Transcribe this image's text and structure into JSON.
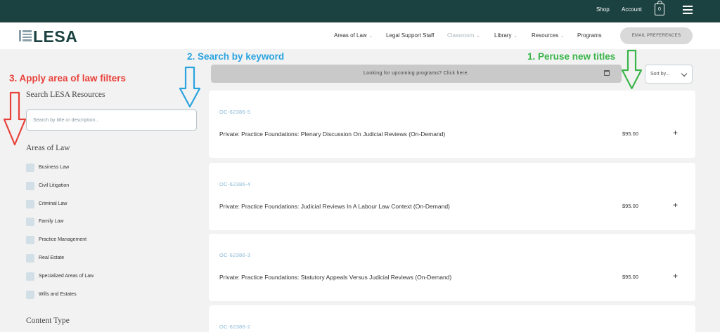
{
  "top_bar": {
    "shop": "Shop",
    "account": "Account",
    "cart_count": "0"
  },
  "brand": {
    "logo_text": "LESA"
  },
  "nav": {
    "items": [
      {
        "label": "Areas of Law",
        "dropdown": true
      },
      {
        "label": "Legal Support Staff",
        "dropdown": false
      },
      {
        "label": "Classroom",
        "dropdown": true
      },
      {
        "label": "Library",
        "dropdown": true
      },
      {
        "label": "Resources",
        "dropdown": true
      },
      {
        "label": "Programs",
        "dropdown": false
      }
    ],
    "email_button": "EMAIL PREFERENCES"
  },
  "annotations": {
    "step1": "1. Peruse new titles",
    "step2": "2. Search by keyword",
    "step3": "3. Apply area of law filters"
  },
  "sidebar": {
    "search_title": "Search LESA Resources",
    "search_placeholder": "Search by title or description...",
    "areas_title": "Areas of Law",
    "areas": [
      "Business Law",
      "Civil Litigation",
      "Criminal Law",
      "Family Law",
      "Practice Management",
      "Real Estate",
      "Specialized Areas of Law",
      "Wills and Estates"
    ],
    "content_type_title": "Content Type"
  },
  "main": {
    "banner": "Looking for upcoming programs? Click here.",
    "sort_label": "Sort by...",
    "cards": [
      {
        "code": "OC-62386-5",
        "title": "Private: Practice Foundations: Plenary Discussion On Judicial Reviews (On-Demand)",
        "price": "$95.00"
      },
      {
        "code": "OC-62386-4",
        "title": "Private: Practice Foundations: Judicial Reviews In A Labour Law Context (On-Demand)",
        "price": "$95.00"
      },
      {
        "code": "OC-62386-3",
        "title": "Private: Practice Foundations: Statutory Appeals Versus Judicial Reviews (On-Demand)",
        "price": "$95.00"
      },
      {
        "code": "OC-62386-2"
      }
    ]
  },
  "colors": {
    "header": "#1b4240",
    "annot_red": "#e8413a",
    "annot_blue": "#2aa3df",
    "annot_green": "#3ab54a",
    "code_blue": "#8ab9d6"
  }
}
